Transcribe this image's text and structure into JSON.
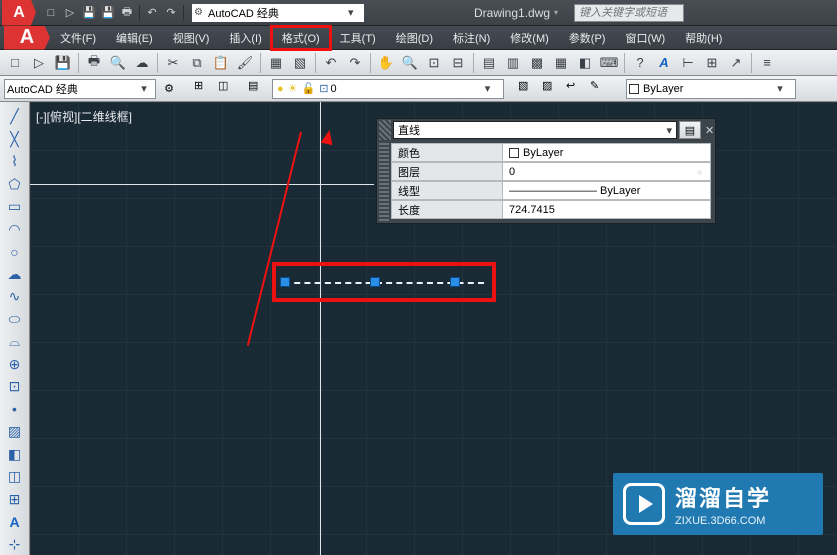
{
  "title": "Drawing1.dwg",
  "search_placeholder": "键入关键字或短语",
  "workspace": "AutoCAD 经典",
  "menus": [
    "文件(F)",
    "编辑(E)",
    "视图(V)",
    "插入(I)",
    "格式(O)",
    "工具(T)",
    "绘图(D)",
    "标注(N)",
    "修改(M)",
    "参数(P)",
    "窗口(W)",
    "帮助(H)"
  ],
  "highlighted_menu_index": 4,
  "propbar": {
    "workspace": "AutoCAD 经典",
    "layer": "0",
    "color": "ByLayer"
  },
  "view_label": "[-][俯视][二维线框]",
  "palette": {
    "object": "直线",
    "rows": [
      {
        "k": "颜色",
        "v": "ByLayer",
        "swatch": true
      },
      {
        "k": "图层",
        "v": "0"
      },
      {
        "k": "线型",
        "v": "———————— ByLayer"
      },
      {
        "k": "长度",
        "v": "724.7415"
      }
    ]
  },
  "watermark": {
    "line1": "溜溜自学",
    "line2": "ZIXUE.3D66.COM"
  }
}
